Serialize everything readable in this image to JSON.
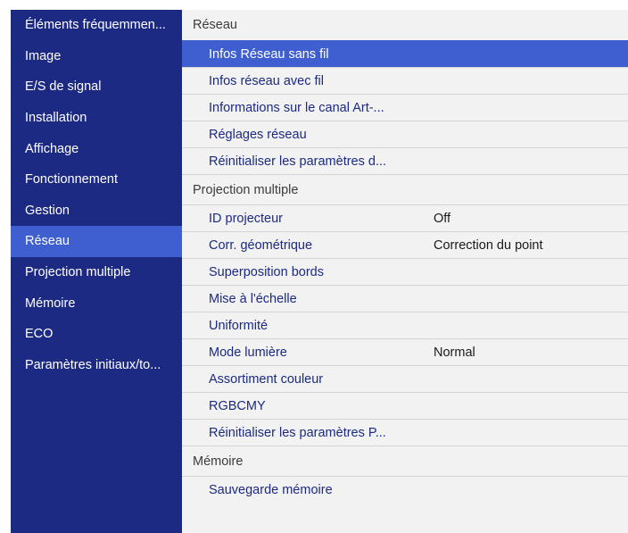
{
  "sidebar": {
    "items": [
      {
        "label": "Éléments fréquemmen..."
      },
      {
        "label": "Image"
      },
      {
        "label": "E/S de signal"
      },
      {
        "label": "Installation"
      },
      {
        "label": "Affichage"
      },
      {
        "label": "Fonctionnement"
      },
      {
        "label": "Gestion"
      },
      {
        "label": "Réseau",
        "selected": true
      },
      {
        "label": "Projection multiple"
      },
      {
        "label": "Mémoire"
      },
      {
        "label": "ECO"
      },
      {
        "label": "Paramètres initiaux/to..."
      }
    ]
  },
  "main": {
    "section_reseau": {
      "title": "Réseau",
      "items": [
        {
          "label": "Infos Réseau sans fil",
          "selected": true
        },
        {
          "label": "Infos réseau avec fil"
        },
        {
          "label": "Informations sur le canal Art-..."
        },
        {
          "label": "Réglages réseau"
        },
        {
          "label": "Réinitialiser les paramètres d..."
        }
      ]
    },
    "section_projection": {
      "title": "Projection multiple",
      "items": [
        {
          "label": "ID projecteur",
          "value": "Off"
        },
        {
          "label": "Corr. géométrique",
          "value": "Correction du point"
        },
        {
          "label": "Superposition bords"
        },
        {
          "label": "Mise à l'échelle"
        },
        {
          "label": "Uniformité"
        },
        {
          "label": "Mode lumière",
          "value": "Normal"
        },
        {
          "label": "Assortiment couleur"
        },
        {
          "label": "RGBCMY"
        },
        {
          "label": "Réinitialiser les paramètres P..."
        }
      ]
    },
    "section_memoire": {
      "title": "Mémoire",
      "items": [
        {
          "label": "Sauvegarde mémoire"
        }
      ]
    }
  },
  "colors": {
    "sidebar_bg": "#1c2a83",
    "selection": "#3f5fd1",
    "panel_bg": "#f2f2f2",
    "item_text": "#1c2a83"
  }
}
